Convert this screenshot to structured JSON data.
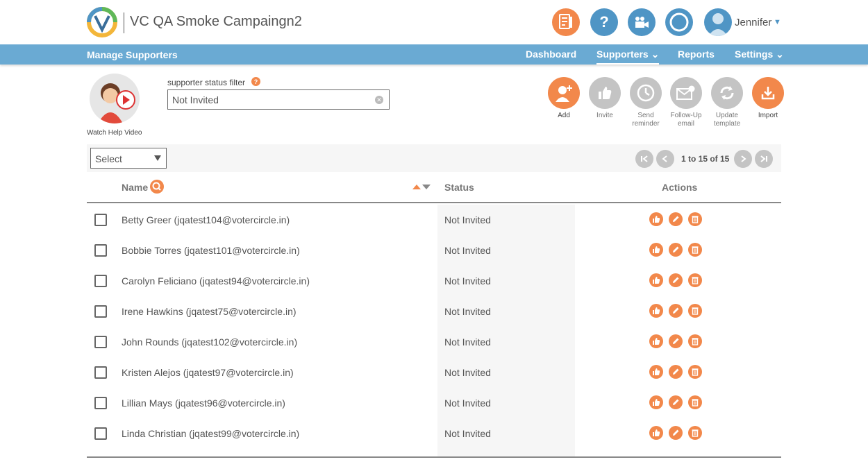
{
  "app": {
    "title": "VC QA Smoke Campaingn2"
  },
  "user": {
    "name": "Jennifer"
  },
  "top_icons": [
    "checklist-icon",
    "help-icon",
    "video-camera-icon",
    "circle-icon"
  ],
  "nav": {
    "title": "Manage Supporters",
    "items": [
      {
        "label": "Dashboard"
      },
      {
        "label": "Supporters",
        "active": true,
        "has_dropdown": true
      },
      {
        "label": "Reports"
      },
      {
        "label": "Settings",
        "has_dropdown": true
      }
    ],
    "chevron": "⌄"
  },
  "help_video": {
    "label": "Watch Help Video"
  },
  "filter": {
    "label": "supporter status filter",
    "help": "?",
    "value": "Not Invited"
  },
  "actions": [
    {
      "label": "Add",
      "enabled": true
    },
    {
      "label": "Invite",
      "enabled": false
    },
    {
      "label": "Send reminder",
      "enabled": false
    },
    {
      "label": "Follow-Up email",
      "enabled": false
    },
    {
      "label": "Update template",
      "enabled": false
    },
    {
      "label": "Import",
      "enabled": true
    }
  ],
  "toolbar": {
    "select_value": "Select",
    "pagination": "1 to 15 of 15"
  },
  "table": {
    "headers": {
      "name": "Name",
      "status": "Status",
      "actions": "Actions"
    },
    "rows": [
      {
        "name": "Betty Greer (jqatest104@votercircle.in)",
        "status": "Not Invited"
      },
      {
        "name": "Bobbie Torres (jqatest101@votercircle.in)",
        "status": "Not Invited"
      },
      {
        "name": "Carolyn Feliciano (jqatest94@votercircle.in)",
        "status": "Not Invited"
      },
      {
        "name": "Irene Hawkins (jqatest75@votercircle.in)",
        "status": "Not Invited"
      },
      {
        "name": "John Rounds (jqatest102@votercircle.in)",
        "status": "Not Invited"
      },
      {
        "name": "Kristen Alejos (jqatest97@votercircle.in)",
        "status": "Not Invited"
      },
      {
        "name": "Lillian Mays (jqatest96@votercircle.in)",
        "status": "Not Invited"
      },
      {
        "name": "Linda Christian (jqatest99@votercircle.in)",
        "status": "Not Invited"
      }
    ]
  },
  "colors": {
    "accent": "#f2884b",
    "nav_bg": "#6aaad3",
    "icon_blue": "#4f95c5",
    "disabled": "#c4c4c4"
  }
}
